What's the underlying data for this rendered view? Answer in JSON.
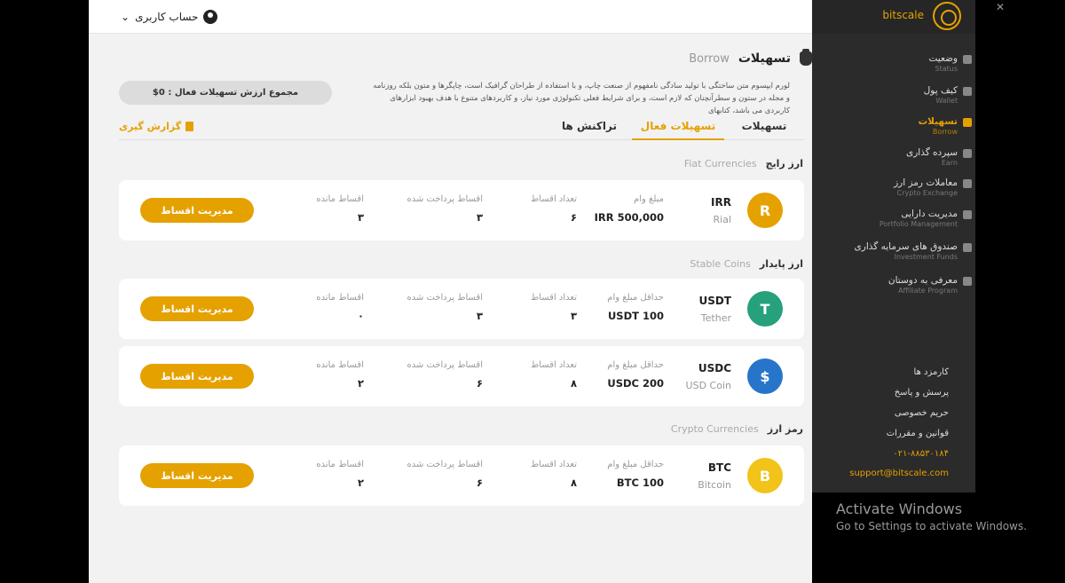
{
  "topbar": {
    "account_label": "حساب کاربری",
    "chevron": "⌄"
  },
  "page": {
    "title": "تسهیلات",
    "subtitle": "Borrow",
    "description": "لورم ایپسوم متن ساختگی با تولید سادگی نامفهوم از صنعت چاپ، و با استفاده از طراحان گرافیک است، چاپگرها و متون بلکه روزنامه و مجله در ستون و سطرآنچنان که لازم است، و برای شرایط فعلی تکنولوژی مورد نیاز، و کاربردهای متنوع با هدف بهبود ابزارهای کاربردی می باشد، کتابهای",
    "total_label": "مجموع ارزش تسهیلات فعال : 0$"
  },
  "tabs": {
    "t1": "تسهیلات",
    "t2": "تسهیلات فعال",
    "t3": "تراکنش ها",
    "report": "گزارش گیری"
  },
  "sections": {
    "fiat": {
      "fa": "ارز رایج",
      "en": "Fiat Currencies"
    },
    "stable": {
      "fa": "ارز پایدار",
      "en": "Stable Coins"
    },
    "crypto": {
      "fa": "رمز ارز",
      "en": "Crypto Currencies"
    }
  },
  "cards": [
    {
      "code": "IRR",
      "name": "Rial",
      "icon": "R",
      "color": "#e5a100",
      "amount_label": "مبلغ وام",
      "amount": "500,000 IRR",
      "count_label": "تعداد اقساط",
      "count": "۶",
      "paid_label": "اقساط پرداخت شده",
      "paid": "۳",
      "remain_label": "اقساط مانده",
      "remain": "۳",
      "button": "مدیریت اقساط"
    },
    {
      "code": "USDT",
      "name": "Tether",
      "icon": "T",
      "color": "#26a17b",
      "amount_label": "حداقل مبلغ وام",
      "amount": "100 USDT",
      "count_label": "تعداد اقساط",
      "count": "۳",
      "paid_label": "اقساط پرداخت شده",
      "paid": "۳",
      "remain_label": "اقساط مانده",
      "remain": "۰",
      "button": "مدیریت اقساط"
    },
    {
      "code": "USDC",
      "name": "USD Coin",
      "icon": "$",
      "color": "#2775ca",
      "amount_label": "حداقل مبلغ وام",
      "amount": "200 USDC",
      "count_label": "تعداد اقساط",
      "count": "۸",
      "paid_label": "اقساط پرداخت شده",
      "paid": "۶",
      "remain_label": "اقساط مانده",
      "remain": "۲",
      "button": "مدیریت اقساط"
    },
    {
      "code": "BTC",
      "name": "Bitcoin",
      "icon": "B",
      "color": "#f2c318",
      "amount_label": "حداقل مبلغ وام",
      "amount": "100 BTC",
      "count_label": "تعداد اقساط",
      "count": "۸",
      "paid_label": "اقساط پرداخت شده",
      "paid": "۶",
      "remain_label": "اقساط مانده",
      "remain": "۲",
      "button": "مدیریت اقساط"
    }
  ],
  "sidebar": {
    "brand": "bitscale",
    "items": [
      {
        "fa": "وضعیت",
        "en": "Status"
      },
      {
        "fa": "کیف پول",
        "en": "Wallet"
      },
      {
        "fa": "تسهیلات",
        "en": "Borrow"
      },
      {
        "fa": "سپرده گذاری",
        "en": "Earn"
      },
      {
        "fa": "معاملات رمز ارز",
        "en": "Crypto Exchange"
      },
      {
        "fa": "مدیریت دارایی",
        "en": "Portfolio Management"
      },
      {
        "fa": "صندوق های سرمایه گذاری",
        "en": "Investment Funds"
      },
      {
        "fa": "معرفی به دوستان",
        "en": "Affiliate Program"
      }
    ],
    "footer": {
      "fees": "کارمزد ها",
      "faq": "پرسش و پاسخ",
      "privacy": "حریم خصوصی",
      "terms": "قوانین و مقررات",
      "phone": "۰۲۱-۸۸۵۳۰۱۸۴",
      "email": "support@bitscale.com"
    }
  },
  "overlay": {
    "activate_title": "Activate Windows",
    "activate_sub": "Go to Settings to activate Windows.",
    "corner_icon": "✕"
  }
}
